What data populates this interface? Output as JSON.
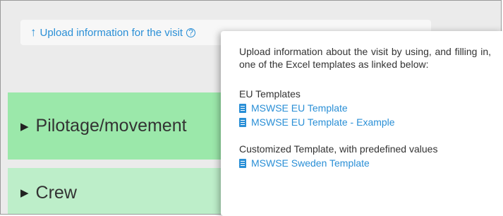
{
  "upload": {
    "label": "Upload information for the visit",
    "arrow_icon": "upload-arrow-icon",
    "help_icon": "help-circle-icon"
  },
  "sections": {
    "pilotage": "Pilotage/movement",
    "crew": "Crew"
  },
  "popover": {
    "description": "Upload information about the visit by using, and filling in, one of the Excel templates as linked below:",
    "eu_group_title": "EU Templates",
    "eu_links": [
      "MSWSE EU Template",
      "MSWSE EU Template - Example"
    ],
    "custom_group_title": "Customized Template, with predefined values",
    "custom_links": [
      "MSWSE Sweden Template"
    ]
  },
  "colors": {
    "link": "#2a8fd6",
    "pilotage_bg": "#9be8aa",
    "crew_bg": "#bdeec9"
  }
}
